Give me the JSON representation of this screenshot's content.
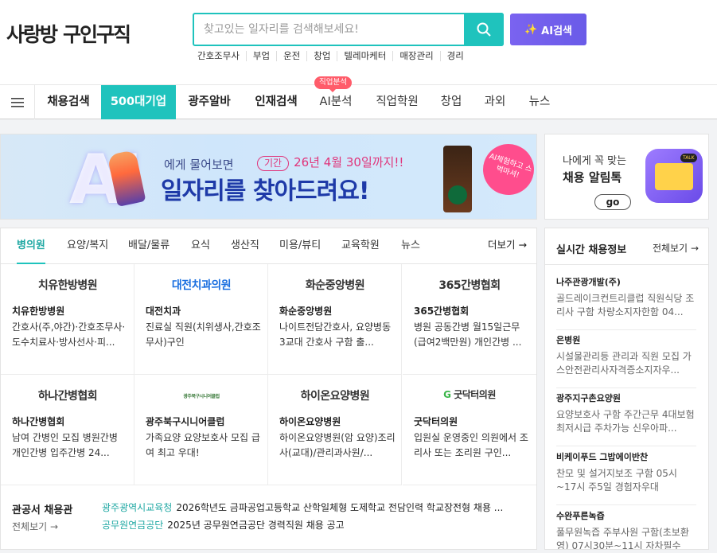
{
  "header": {
    "logo_part1": "사랑방",
    "logo_part2": "구인구직",
    "search_placeholder": "찾고있는 일자리를 검색해보세요!",
    "ai_button": "AI검색",
    "keywords": [
      "간호조무사",
      "부업",
      "운전",
      "창업",
      "텔레마케터",
      "매장관리",
      "경리"
    ]
  },
  "nav": {
    "items": [
      "채용검색",
      "500대기업",
      "광주알바",
      "인재검색",
      "AI분석",
      "직업학원",
      "창업",
      "과외",
      "뉴스"
    ],
    "badge": "직업분석"
  },
  "banner": {
    "ai_letters": "AI",
    "line1": "에게 물어보면",
    "line2": "일자리를 찾아드려요!",
    "period_tag": "기간",
    "period": "26년 4월 30일까지!!",
    "bubble": "AI체험하고 스벅마셔!"
  },
  "ad": {
    "line1": "나에게 꼭 맞는",
    "line2": "채용 알림톡",
    "go": "go"
  },
  "tabs": {
    "items": [
      "병의원",
      "요양/복지",
      "배달/물류",
      "요식",
      "생산직",
      "미용/뷰티",
      "교육학원",
      "뉴스"
    ],
    "more": "더보기"
  },
  "cards": [
    {
      "logo": "치유한방병원",
      "name": "치유한방병원",
      "desc": "간호사(주,야간)·간호조무사·도수치료사·방사선사·피..."
    },
    {
      "logo": "대전치과의원",
      "name": "대전치과",
      "desc": "진료실 직원(치위생사,간호조무사)구인"
    },
    {
      "logo": "화순중앙병원",
      "name": "화순중앙병원",
      "desc": "나이트전담간호사, 요양병동 3교대 간호사 구함 출..."
    },
    {
      "logo": "365간병협회",
      "name": "365간병협회",
      "desc": "병원 공동간병 월15일근무(급여2백만원) 개인간병 ..."
    },
    {
      "logo": "하나간병협회",
      "name": "하나간병협회",
      "desc": "남여 간병인 모집 병원간병 개인간병 입주간병 24..."
    },
    {
      "logo": "광주북구시니어클럽",
      "name": "광주북구시니어클럽",
      "desc": "가족요양 요양보호사 모집 급여 최고 우대!"
    },
    {
      "logo": "하이온요양병원",
      "name": "하이온요양병원",
      "desc": "하이온요양병원(암 요양)조리사(교대)/관리과사원/..."
    },
    {
      "logo": "굿닥터의원",
      "name": "굿닥터의원",
      "desc": "입원실 운영중인 의원에서 조리사 또는 조리원 구인..."
    }
  ],
  "public": {
    "title": "관공서 채용관",
    "all": "전체보기",
    "rows": [
      {
        "org": "광주광역시교육청",
        "text": "2026학년도 금파공업고등학교 산학일체형 도제학교 전담인력 학교장전형 채용 ..."
      },
      {
        "org": "공무원연금공단",
        "text": "2025년 공무원연금공단 경력직원 채용 공고"
      }
    ]
  },
  "side": {
    "title": "실시간 채용정보",
    "all": "전체보기",
    "items": [
      {
        "name": "나주관광개발(주)",
        "desc": "골드레이크컨트리클럽 직원식당 조리사 구함 차량소지자한함 04..."
      },
      {
        "name": "은병원",
        "desc": "시설물관리등 관리과 직원 모집 가스안전관리사자격증소지자우..."
      },
      {
        "name": "광주지구촌요양원",
        "desc": "요양보호사 구함 주간근무 4대보험 최저시급 주차가능 신우아파..."
      },
      {
        "name": "비케이푸드 그밥에이반찬",
        "desc": "찬모 및 설거지보조 구함 05시~17시 주5일 경험자우대"
      },
      {
        "name": "수완푸른녹즙",
        "desc": "풀무원녹즙 주부사원 구함(초보환영) 07시30분~11시 자차필수 월..."
      }
    ]
  },
  "colors": {
    "accent": "#1fc3bd",
    "ai": "#7a63f0",
    "badge": "#ff5c6a"
  }
}
